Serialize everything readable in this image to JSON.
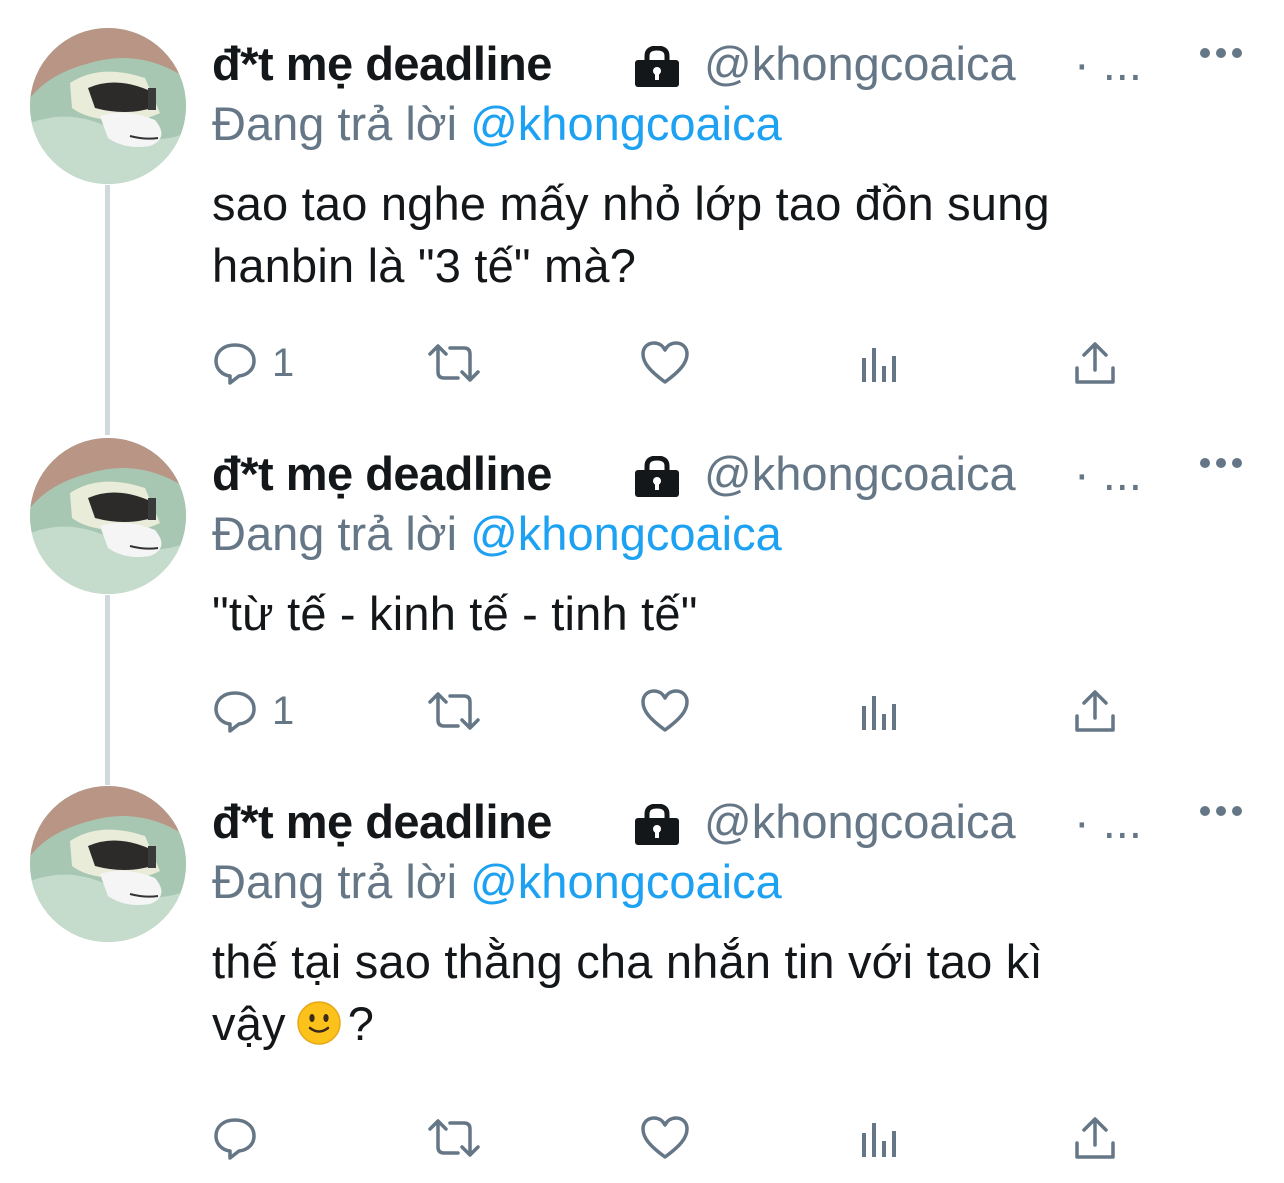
{
  "thread": {
    "tweets": [
      {
        "display_name": "đ*t mẹ deadline",
        "handle": "@khongcoaica",
        "separator": "· ...",
        "replying_prefix": "Đang trả lời",
        "replying_to": "@khongcoaica",
        "body_lines": [
          "sao tao nghe mấy nhỏ lớp tao đồn sung",
          "hanbin là \"3 tế\" mà?"
        ],
        "reply_count": "1"
      },
      {
        "display_name": "đ*t mẹ deadline",
        "handle": "@khongcoaica",
        "separator": "· ...",
        "replying_prefix": "Đang trả lời",
        "replying_to": "@khongcoaica",
        "body_lines": [
          "\"từ tế - kinh tế - tinh tế\""
        ],
        "reply_count": "1"
      },
      {
        "display_name": "đ*t mẹ deadline",
        "handle": "@khongcoaica",
        "separator": "· ...",
        "replying_prefix": "Đang trả lời",
        "replying_to": "@khongcoaica",
        "body_lines": [
          "thế tại sao thằng cha nhắn tin với tao kì",
          "vậy"
        ],
        "body_suffix": "?",
        "reply_count": ""
      }
    ]
  },
  "icons": {
    "lock": "lock-icon",
    "more": "more-horizontal-icon",
    "reply": "reply-bubble-icon",
    "retweet": "retweet-icon",
    "like": "heart-icon",
    "analytics": "analytics-bars-icon",
    "share": "share-upload-icon",
    "emoji": "slightly-smiling-face-icon"
  },
  "colors": {
    "text": "#14171a",
    "secondary": "#657786",
    "link": "#1da1f2",
    "thread_line": "#cfd9de"
  }
}
